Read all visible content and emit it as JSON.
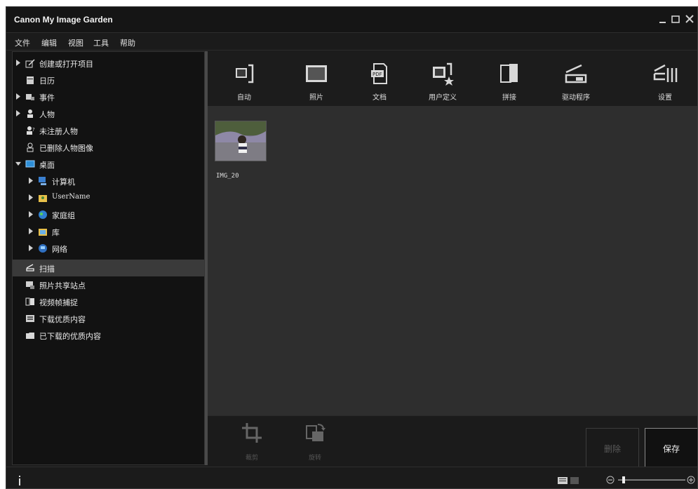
{
  "window": {
    "title": "Canon My Image Garden"
  },
  "menu": [
    "文件",
    "编辑",
    "视图",
    "工具",
    "帮助"
  ],
  "sidebar": {
    "items": [
      {
        "label": "创建或打开项目",
        "icon": "create-project-icon",
        "expandable": true
      },
      {
        "label": "日历",
        "icon": "calendar-icon",
        "expandable": false
      },
      {
        "label": "事件",
        "icon": "event-icon",
        "expandable": true
      },
      {
        "label": "人物",
        "icon": "person-icon",
        "expandable": true
      },
      {
        "label": "未注册人物",
        "icon": "unregistered-person-icon",
        "expandable": false
      },
      {
        "label": "已删除人物图像",
        "icon": "deleted-person-icon",
        "expandable": false
      },
      {
        "label": "桌面",
        "icon": "desktop-icon",
        "expandable": true,
        "expanded": true
      },
      {
        "label": "计算机",
        "icon": "computer-icon",
        "expandable": true
      },
      {
        "label": "UserName",
        "icon": "user-folder-icon",
        "expandable": true
      },
      {
        "label": "家庭组",
        "icon": "homegroup-icon",
        "expandable": true
      },
      {
        "label": "库",
        "icon": "library-icon",
        "expandable": true
      },
      {
        "label": "网络",
        "icon": "network-icon",
        "expandable": true
      },
      {
        "label": "扫描",
        "icon": "scan-icon",
        "expandable": false,
        "selected": true
      },
      {
        "label": "照片共享站点",
        "icon": "photo-share-icon",
        "expandable": false
      },
      {
        "label": "视频帧捕捉",
        "icon": "video-capture-icon",
        "expandable": false
      },
      {
        "label": "下载优质内容",
        "icon": "download-content-icon",
        "expandable": false
      },
      {
        "label": "已下载的优质内容",
        "icon": "folder-icon",
        "expandable": false
      }
    ]
  },
  "toolbar": {
    "buttons": [
      {
        "label": "自动",
        "icon": "auto-scan-icon"
      },
      {
        "label": "照片",
        "icon": "photo-scan-icon"
      },
      {
        "label": "文档",
        "icon": "document-scan-icon"
      },
      {
        "label": "用户定义",
        "icon": "custom-scan-icon"
      },
      {
        "label": "拼接",
        "icon": "stitch-scan-icon"
      },
      {
        "label": "驱动程序",
        "icon": "driver-icon"
      },
      {
        "label": "设置",
        "icon": "settings-icon"
      }
    ]
  },
  "content": {
    "thumbnail_caption": "IMG_20"
  },
  "bottom": {
    "crop_label": "裁剪",
    "rotate_label": "旋转",
    "delete_label": "删除",
    "save_label": "保存"
  },
  "colors": {
    "background": "#1b1b1b",
    "content": "#2e2e2e",
    "selected_row": "#3a3a3a",
    "desktop_blue": "#2e8fd8"
  }
}
